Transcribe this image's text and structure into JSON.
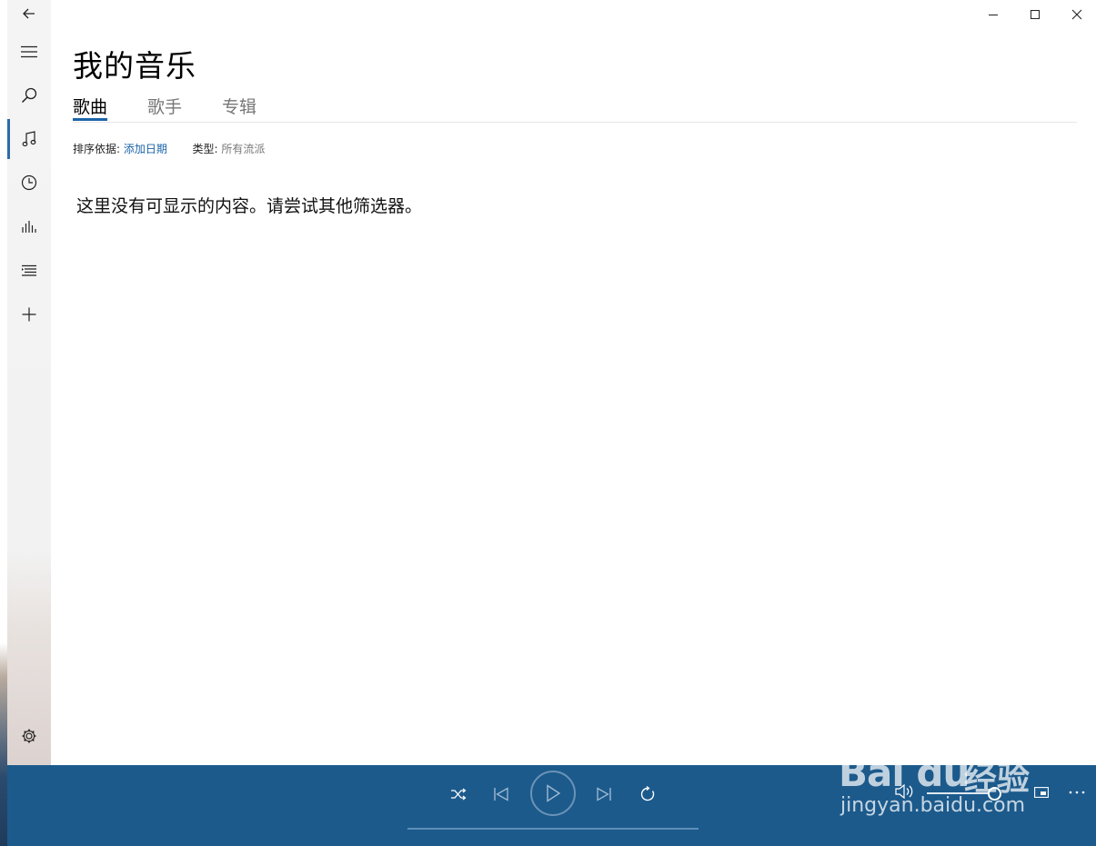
{
  "app": {
    "page_title": "我的音乐"
  },
  "tabs": [
    {
      "label": "歌曲",
      "active": true
    },
    {
      "label": "歌手",
      "active": false
    },
    {
      "label": "专辑",
      "active": false
    }
  ],
  "filters": {
    "sort_label": "排序依据:",
    "sort_value": "添加日期",
    "genre_label": "类型:",
    "genre_value": "所有流派"
  },
  "content": {
    "empty_message": "这里没有可显示的内容。请尝试其他筛选器。"
  },
  "sidebar": {
    "items": [
      {
        "icon": "back-arrow-icon"
      },
      {
        "icon": "hamburger-menu-icon"
      },
      {
        "icon": "search-icon"
      },
      {
        "icon": "music-note-icon",
        "active": true
      },
      {
        "icon": "clock-icon"
      },
      {
        "icon": "equalizer-icon"
      },
      {
        "icon": "playlist-icon"
      },
      {
        "icon": "plus-icon"
      },
      {
        "icon": "gear-icon"
      }
    ]
  },
  "watermark": {
    "brand": "Bai du",
    "suffix": "经验",
    "url": "jingyan.baidu.com"
  },
  "colors": {
    "accent": "#1b64a8",
    "player_bg": "#1c5a8c",
    "sidebar_bg": "#f2f2f2"
  }
}
